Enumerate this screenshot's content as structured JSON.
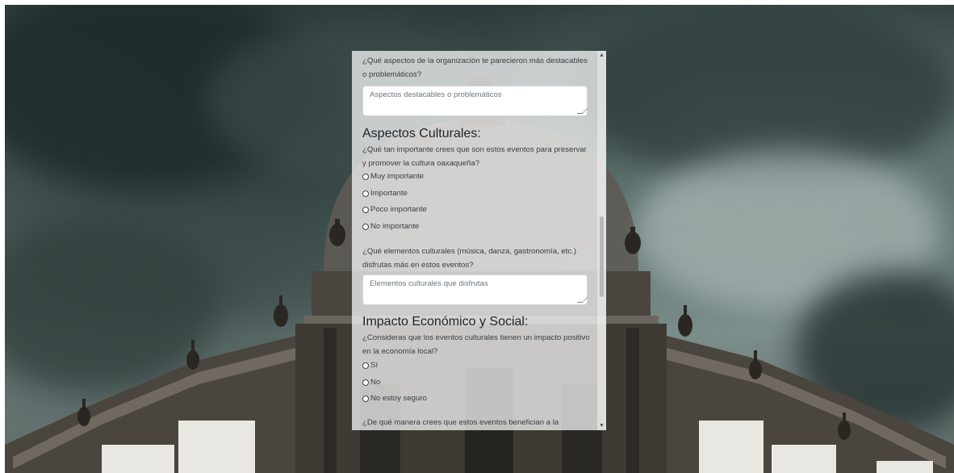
{
  "form": {
    "q_problems": "¿Qué aspectos de la organización te parecieron más destacables o problemáticos?",
    "q_problems_placeholder": "Aspectos destacables o problemáticos",
    "cultural_heading": "Aspectos Culturales:",
    "q_importance": "¿Qué tan importante crees que son estos eventos para preservar y promover la cultura oaxaqueña?",
    "importance_options": [
      "Muy importante",
      "Importante",
      "Poco importante",
      "No importante"
    ],
    "q_elements": "¿Qué elementos culturales (música, danza, gastronomía, etc.) disfrutas más en estos eventos?",
    "q_elements_placeholder": "Elementos culturales que disfrutas",
    "economic_heading": "Impacto Económico y Social:",
    "q_economy": "¿Consideras que los eventos culturales tienen un impacto positivo en la economía local?",
    "economy_options": [
      "Sí",
      "No",
      "No estoy seguro"
    ],
    "q_benefit": "¿De qué manera crees que estos eventos benefician a la"
  },
  "scrollbar": {
    "up_icon": "chevron-up-icon",
    "down_icon": "chevron-down-icon"
  }
}
